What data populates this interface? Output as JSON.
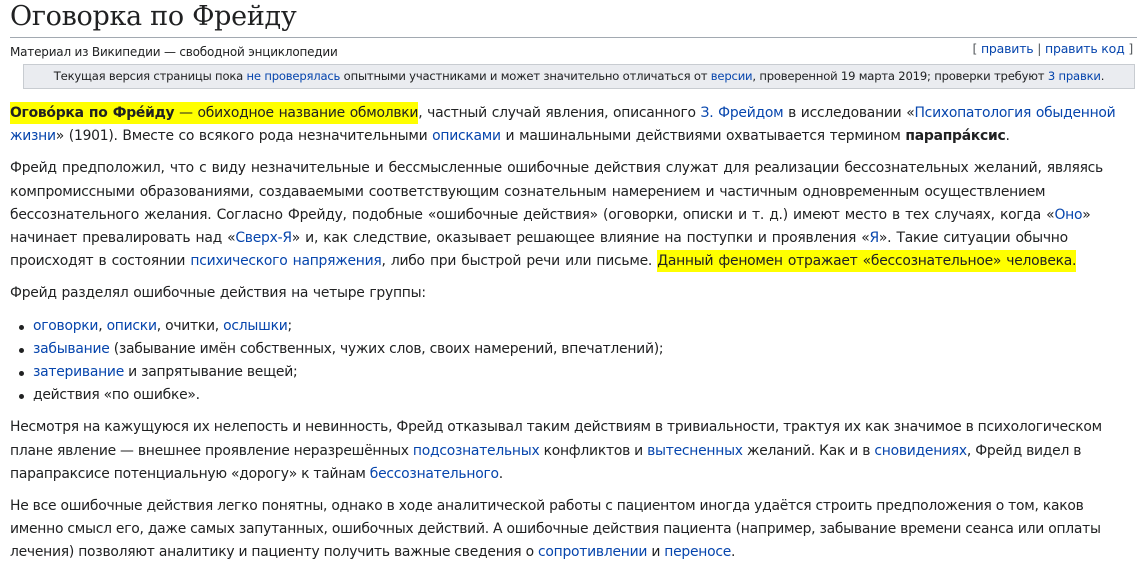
{
  "title": "Оговорка по Фрейду",
  "site_sub": "Материал из Википедии — свободной энциклопедии",
  "edit": {
    "bracket_open": "[ ",
    "edit_label": "править",
    "sep": " | ",
    "edit_code_label": "править код",
    "bracket_close": " ]"
  },
  "flagged_revs": {
    "t1": "Текущая версия страницы пока ",
    "l1": "не проверялась",
    "t2": " опытными участниками и может значительно отличаться от ",
    "l2": "версии",
    "t3": ", проверенной 19 марта 2019; проверки требуют ",
    "l3": "3 правки",
    "t4": "."
  },
  "p1": {
    "bold": "Огово́рка по Фре́йду",
    "hl_rest": " — обиходное название обмолвки",
    "t1": ", частный случай явления, описанного ",
    "l1": "З. Фрейдом",
    "t2": " в исследовании «",
    "l2": "Психопатология обыденной жизни",
    "t3": "» (1901). Вместе со всякого рода незначительными ",
    "l3": "описками",
    "t4": " и машинальными действиями охватывается термином ",
    "term": "парапра́ксис",
    "t5": "."
  },
  "p2": {
    "t1": "Фрейд предположил, что с виду незначительные и бессмысленные ошибочные действия служат для реализации бессознательных желаний, являясь компромиссными образованиями, создаваемыми соответствующим сознательным намерением и частичным одновременным осуществлением бессознательного желания. Согласно Фрейду, подобные «ошибочные действия» (оговорки, описки и т. д.) имеют место в тех случаях, когда «",
    "l1": "Оно",
    "t2": "» начинает превалировать над «",
    "l2": "Сверх-Я",
    "t3": "» и, как следствие, оказывает решающее влияние на поступки и проявления «",
    "l3": "Я",
    "t4": "». Такие ситуации обычно происходят в состоянии ",
    "l4": "психического напряжения",
    "t5": ", либо при быстрой речи или письме. ",
    "highlight": "Данный феномен отражает «бессознательное» человека."
  },
  "p3": "Фрейд разделял ошибочные действия на четыре группы:",
  "list": {
    "i1": {
      "l1": "оговорки",
      "s1": ", ",
      "l2": "описки",
      "t1": ", очитки, ",
      "l3": "ослышки",
      "t2": ";"
    },
    "i2": {
      "l1": "забывание",
      "t1": " (забывание имён собственных, чужих слов, своих намерений, впечатлений);"
    },
    "i3": {
      "l1": "затеривание",
      "t1": " и запрятывание вещей;"
    },
    "i4": {
      "t1": "действия «по ошибке»."
    }
  },
  "p4": {
    "t1": "Несмотря на кажущуюся их нелепость и невинность, Фрейд отказывал таким действиям в тривиальности, трактуя их как значимое в психологическом плане явление — внешнее проявление неразрешённых ",
    "l1": "подсознательных",
    "t2": " конфликтов и ",
    "l2": "вытесненных",
    "t3": " желаний. Как и в ",
    "l3": "сновидениях",
    "t4": ", Фрейд видел в парапраксисе потенциальную «дорогу» к тайнам ",
    "l4": "бессознательного",
    "t5": "."
  },
  "p5": {
    "t1": "Не все ошибочные действия легко понятны, однако в ходе аналитической работы с пациентом иногда удаётся строить предположения о том, каков именно смысл его, даже самых запутанных, ошибочных действий. А ошибочные действия пациента (например, забывание времени сеанса или оплаты лечения) позволяют аналитику и пациенту получить важные сведения о ",
    "l1": "сопротивлении",
    "t2": " и ",
    "l2": "переносе",
    "t3": "."
  }
}
